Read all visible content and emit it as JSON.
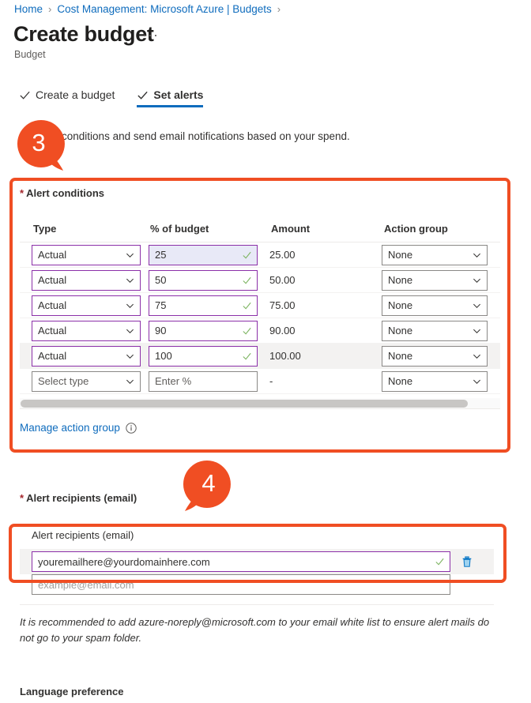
{
  "breadcrumb": {
    "items": [
      {
        "label": "Home"
      },
      {
        "label": "Cost Management: Microsoft Azure | Budgets"
      }
    ],
    "separator": "›"
  },
  "header": {
    "title": "Create budget",
    "ellipsis": "···",
    "subtitle": "Budget"
  },
  "tabs": [
    {
      "label": "Create a budget",
      "icon": "check-icon",
      "active": false
    },
    {
      "label": "Set alerts",
      "icon": "check-icon",
      "active": true
    }
  ],
  "description": "Set alert conditions and send email notifications based on your spend.",
  "callouts": [
    {
      "number": "3",
      "color": "#f04e23"
    },
    {
      "number": "4",
      "color": "#f04e23"
    }
  ],
  "alert_conditions": {
    "label": "Alert conditions",
    "required_marker": "*",
    "columns": [
      "Type",
      "% of budget",
      "Amount",
      "Action group"
    ],
    "rows": [
      {
        "type": "Actual",
        "percent": "25",
        "amount": "25.00",
        "action_group": "None",
        "focused": true,
        "highlight": false
      },
      {
        "type": "Actual",
        "percent": "50",
        "amount": "50.00",
        "action_group": "None",
        "focused": false,
        "highlight": false
      },
      {
        "type": "Actual",
        "percent": "75",
        "amount": "75.00",
        "action_group": "None",
        "focused": false,
        "highlight": false
      },
      {
        "type": "Actual",
        "percent": "90",
        "amount": "90.00",
        "action_group": "None",
        "focused": false,
        "highlight": false
      },
      {
        "type": "Actual",
        "percent": "100",
        "amount": "100.00",
        "action_group": "None",
        "focused": false,
        "highlight": true
      },
      {
        "type": "Select type",
        "percent": "Enter %",
        "amount": "-",
        "action_group": "None",
        "empty": true
      }
    ],
    "manage_link": "Manage action group",
    "info_icon": "info-circle-icon"
  },
  "alert_recipients": {
    "label": "Alert recipients (email)",
    "required_marker": "*",
    "card_header": "Alert recipients (email)",
    "email_value": "youremailhere@yourdomainhere.com",
    "email_placeholder": "example@email.com",
    "delete_icon": "trash-icon",
    "valid_icon": "checkmark-icon"
  },
  "recommendation_note": "It is recommended to add azure-noreply@microsoft.com to your email white list to ensure alert mails do not go to your spam folder.",
  "language_preference": "Language preference",
  "colors": {
    "accent_blue": "#0f6cbd",
    "callout_orange": "#f04e23",
    "required_red": "#a4262c",
    "field_purple": "#8b2fa8",
    "valid_green": "#7db461",
    "focus_background": "#e8e9f7",
    "row_highlight": "#f3f2f1"
  }
}
